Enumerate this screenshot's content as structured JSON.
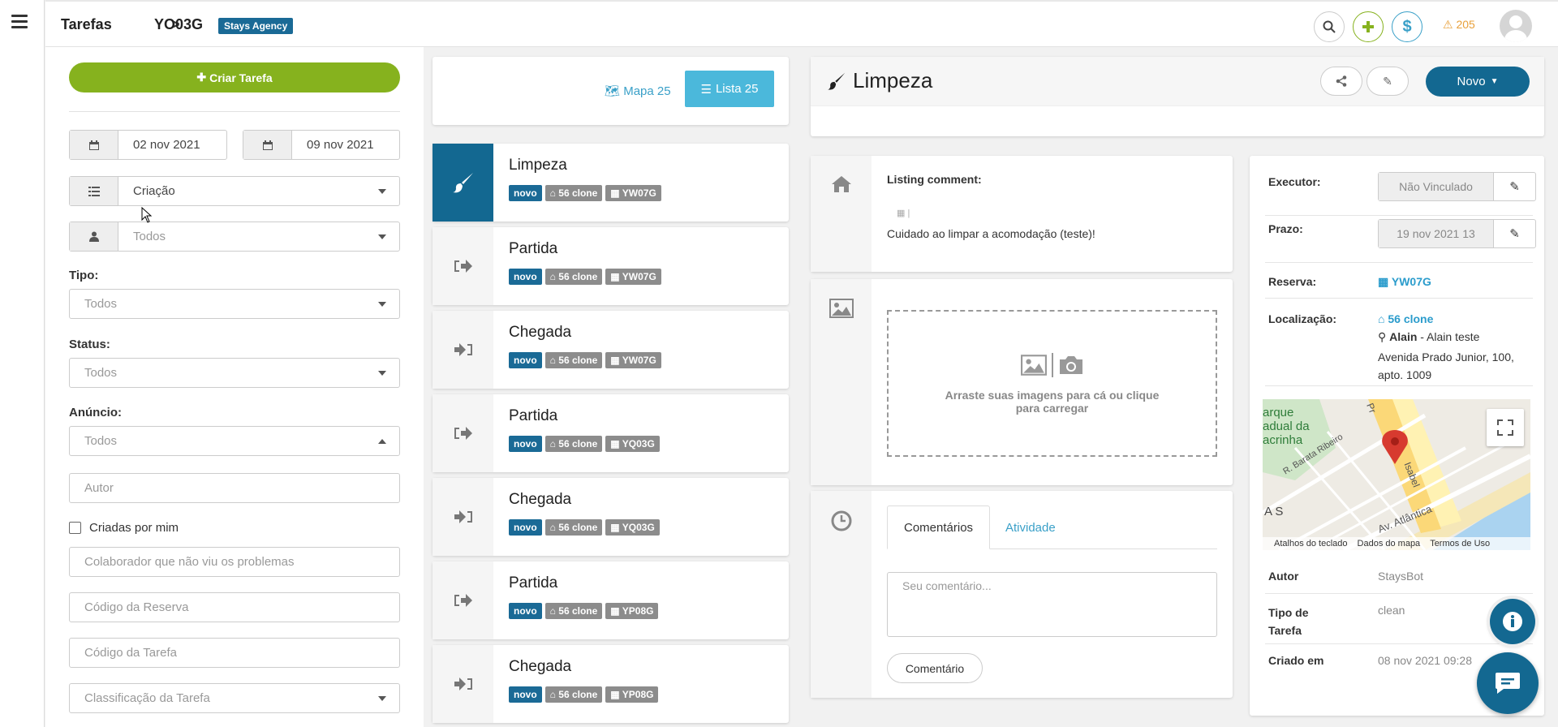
{
  "header": {
    "breadcrumb_1": "Tarefas",
    "breadcrumb_sep": ">",
    "breadcrumb_2": "YO03G",
    "agency_badge": "Stays Agency",
    "alert_count": "205"
  },
  "filters": {
    "create_button": "Criar Tarefa",
    "date_from": "02 nov 2021",
    "date_to": "09 nov 2021",
    "sort_value": "Criação",
    "user_value": "Todos",
    "tipo_label": "Tipo:",
    "tipo_value": "Todos",
    "status_label": "Status:",
    "status_value": "Todos",
    "anuncio_label": "Anúncio:",
    "anuncio_value": "Todos",
    "autor_placeholder": "Autor",
    "criadas_label": "Criadas por mim",
    "colaborador_placeholder": "Colaborador que não viu os problemas",
    "codigo_reserva_placeholder": "Código da Reserva",
    "codigo_tarefa_placeholder": "Código da Tarefa",
    "classificacao_placeholder": "Classificação da Tarefa"
  },
  "list": {
    "mapa_label": "Mapa 25",
    "lista_label": "Lista 25",
    "tasks": [
      {
        "title": "Limpeza",
        "status": "novo",
        "place": "56 clone",
        "code": "YW07G"
      },
      {
        "title": "Partida",
        "status": "novo",
        "place": "56 clone",
        "code": "YW07G"
      },
      {
        "title": "Chegada",
        "status": "novo",
        "place": "56 clone",
        "code": "YW07G"
      },
      {
        "title": "Partida",
        "status": "novo",
        "place": "56 clone",
        "code": "YQ03G"
      },
      {
        "title": "Chegada",
        "status": "novo",
        "place": "56 clone",
        "code": "YQ03G"
      },
      {
        "title": "Partida",
        "status": "novo",
        "place": "56 clone",
        "code": "YP08G"
      },
      {
        "title": "Chegada",
        "status": "novo",
        "place": "56 clone",
        "code": "YP08G"
      }
    ]
  },
  "detail": {
    "title": "Limpeza",
    "novo_button": "Novo",
    "comment_label": "Listing comment:",
    "comment_text": "Cuidado ao limpar a acomodação (teste)!",
    "drop_text": "Arraste suas imagens para cá ou clique para carregar",
    "tab_comments": "Comentários",
    "tab_activity": "Atividade",
    "comment_placeholder": "Seu comentário...",
    "comment_button": "Comentário"
  },
  "info": {
    "executor_label": "Executor:",
    "executor_value": "Não Vinculado",
    "prazo_label": "Prazo:",
    "prazo_value": "19 nov 2021 13",
    "reserva_label": "Reserva:",
    "reserva_value": "YW07G",
    "local_label": "Localização:",
    "local_place": "56 clone",
    "local_owner": "Alain",
    "local_owner_rest": " - Alain teste",
    "local_address": "Avenida Prado Junior, 100, apto. 1009",
    "autor_label": "Autor",
    "autor_value": "StaysBot",
    "tipo_label": "Tipo de Tarefa",
    "tipo_value": "clean",
    "criado_label": "Criado em",
    "criado_value": "08 nov 2021 09:28"
  },
  "map": {
    "label_1": "arque",
    "label_2": "adual da",
    "label_3": "acrinha",
    "street_1": "R. Barata Ribeiro",
    "street_2": "Av. Atlântica",
    "street_3": "Isabel",
    "street_4": "Pr",
    "label_as": "A S",
    "attr_1": "Atalhos do teclado",
    "attr_2": "Dados do mapa",
    "attr_3": "Termos de Uso"
  }
}
